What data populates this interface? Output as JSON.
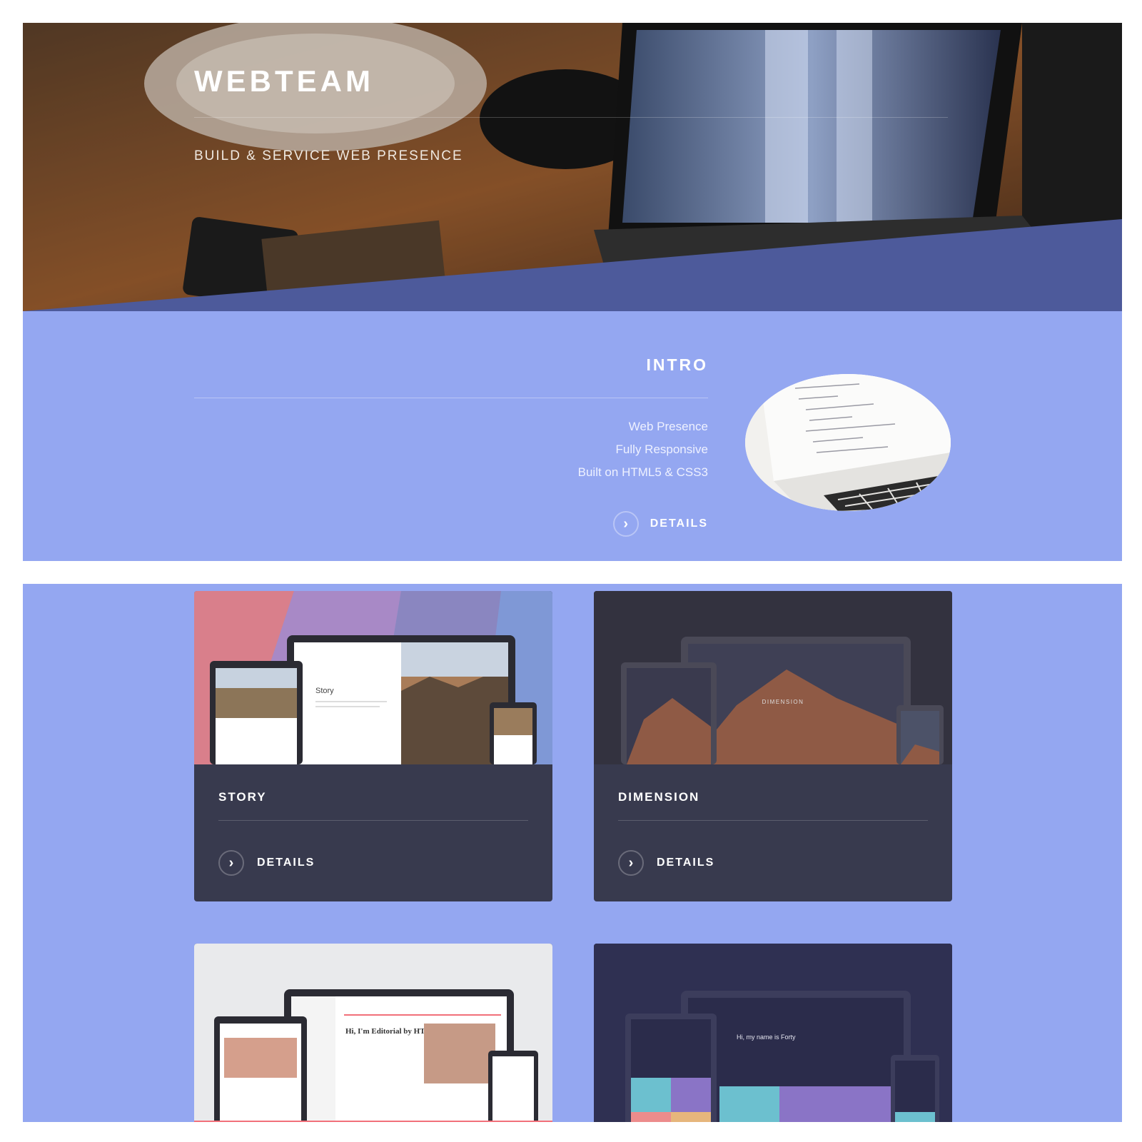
{
  "hero": {
    "title": "WEBTEAM",
    "subtitle": "BUILD & SERVICE WEB PRESENCE"
  },
  "intro": {
    "title": "INTRO",
    "features": [
      "Web Presence",
      "Fully Responsive",
      "Built on HTML5 & CSS3"
    ],
    "details_label": "DETAILS"
  },
  "cards": [
    {
      "title": "STORY",
      "details_label": "DETAILS",
      "mock_heading": "Story"
    },
    {
      "title": "DIMENSION",
      "details_label": "DETAILS",
      "mock_heading": "DIMENSION"
    },
    {
      "title": "",
      "mock_heading": "Hi, I'm Editorial by HTML5 UP"
    },
    {
      "title": "",
      "mock_heading": "Hi, my name is Forty"
    }
  ],
  "colors": {
    "accent": "#94a7f1",
    "hero_band": "#4d5a9b",
    "card_bg": "#383a4e"
  }
}
